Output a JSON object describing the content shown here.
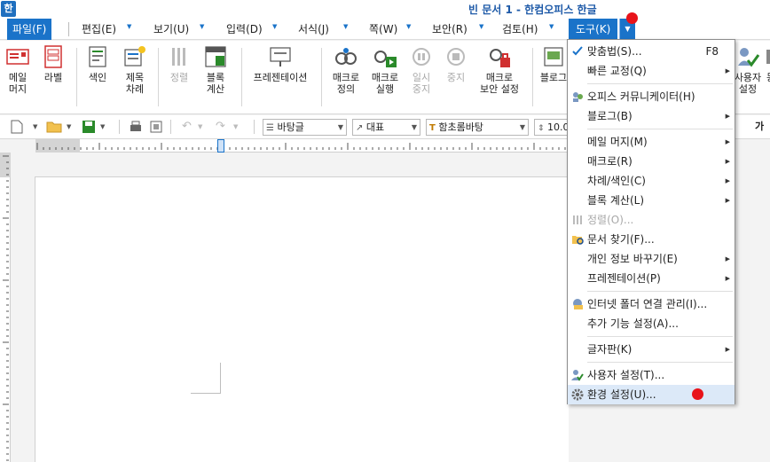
{
  "window": {
    "title": "빈 문서 1 - 한컴오피스 한글",
    "app_icon_glyph": "한"
  },
  "menubar": {
    "file": "파일(F)",
    "edit": "편집(E)",
    "view": "보기(U)",
    "input": "입력(D)",
    "format": "서식(J)",
    "page": "쪽(W)",
    "security": "보안(R)",
    "review": "검토(H)",
    "tools": "도구(K)"
  },
  "ribbon": {
    "mail_merge": "메일\n머지",
    "label": "라벨",
    "index": "색인",
    "title_toc": "제목\n차례",
    "sort": "정렬",
    "block_calc": "블록\n계산",
    "presentation": "프레젠테이션",
    "macro_define": "매크로\n정의",
    "macro_run": "매크로\n실행",
    "macro_pause": "일시\n중지",
    "macro_stop": "중지",
    "macro_security": "매크로\n보안 설정",
    "blog": "블로그",
    "user_settings": "사용자\n설정",
    "sync": "동"
  },
  "quickbar": {
    "style": "바탕글",
    "language": "대표",
    "font": "함초롬바탕",
    "font_size": "10.0",
    "font_icon_glyph": "가"
  },
  "tools_menu": {
    "items": [
      {
        "label": "맞춤법(S)...",
        "shortcut": "F8",
        "icon": "spellcheck-icon"
      },
      {
        "label": "빠른 교정(Q)",
        "icon": "none"
      },
      {
        "label": "오피스 커뮤니케이터(H)",
        "icon": "communicator-icon"
      },
      {
        "label": "블로그(B)",
        "icon": "none"
      },
      {
        "label": "메일 머지(M)",
        "icon": "none"
      },
      {
        "label": "매크로(R)",
        "icon": "none"
      },
      {
        "label": "차례/색인(C)",
        "icon": "none"
      },
      {
        "label": "블록 계산(L)",
        "icon": "none"
      },
      {
        "label": "정렬(O)...",
        "icon": "sort-icon"
      },
      {
        "label": "문서 찾기(F)...",
        "icon": "folder-search-icon"
      },
      {
        "label": "개인 정보 바꾸기(E)",
        "icon": "none"
      },
      {
        "label": "프레젠테이션(P)",
        "icon": "none"
      },
      {
        "label": "인터넷 폴더 연결 관리(I)...",
        "icon": "internet-folder-icon"
      },
      {
        "label": "추가 기능 설정(A)...",
        "icon": "none"
      },
      {
        "label": "글자판(K)",
        "icon": "none"
      },
      {
        "label": "사용자 설정(T)...",
        "icon": "user-settings-icon"
      },
      {
        "label": "환경 설정(U)...",
        "icon": "gear-icon"
      }
    ]
  },
  "colors": {
    "accent": "#1a73c9",
    "highlight": "#dce9f8",
    "marker": "#e8131a"
  }
}
